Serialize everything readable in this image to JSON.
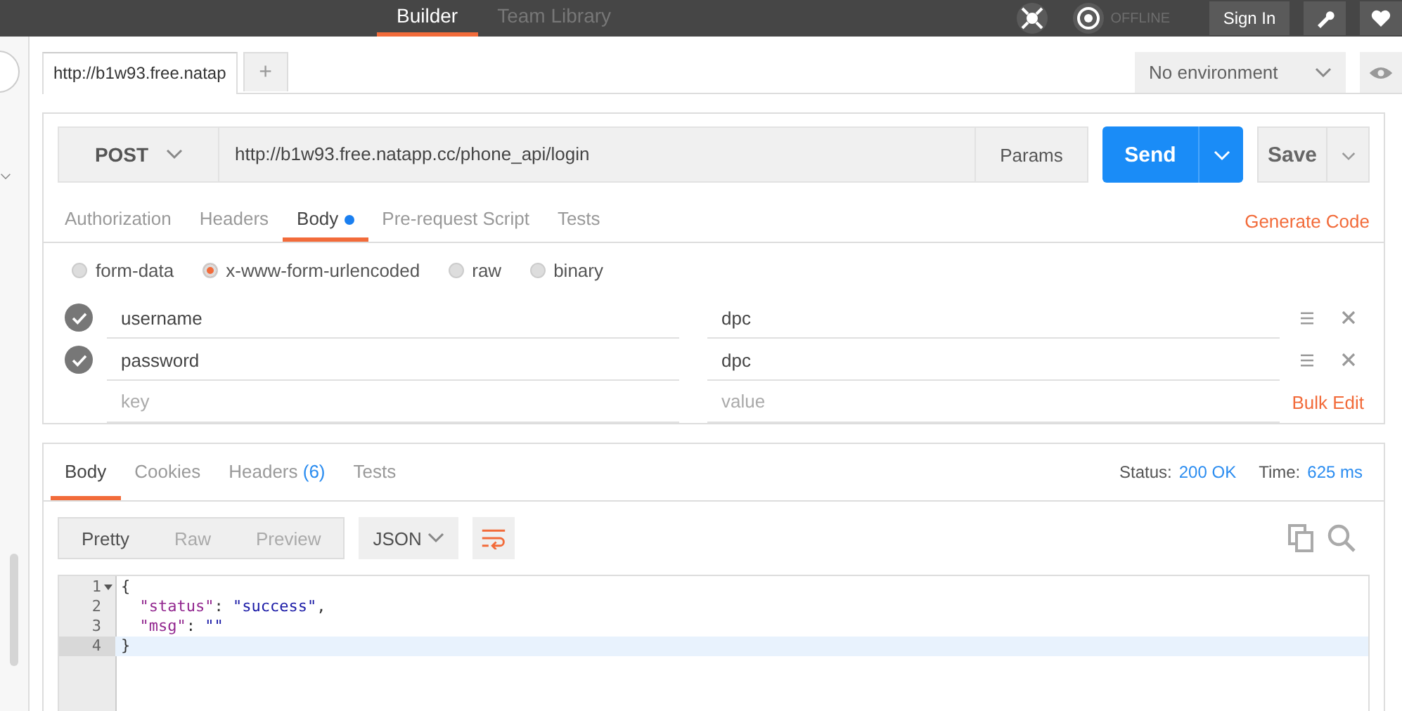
{
  "top_bar": {
    "tabs": [
      {
        "label": "Builder",
        "selected": true
      },
      {
        "label": "Team Library",
        "selected": false
      }
    ],
    "connection": "OFFLINE",
    "sign_in": "Sign In"
  },
  "request_tabs": [
    {
      "label": "http://b1w93.free.natap",
      "selected": true
    }
  ],
  "new_tab": "+",
  "environment": "No environment",
  "request": {
    "method": "POST",
    "url": "http://b1w93.free.natapp.cc/phone_api/login",
    "params": "Params",
    "send": "Send",
    "save": "Save"
  },
  "request_sections": [
    {
      "label": "Authorization",
      "selected": false,
      "dot": false
    },
    {
      "label": "Headers",
      "selected": false,
      "dot": false
    },
    {
      "label": "Body",
      "selected": true,
      "dot": true
    },
    {
      "label": "Pre-request Script",
      "selected": false,
      "dot": false
    },
    {
      "label": "Tests",
      "selected": false,
      "dot": false
    }
  ],
  "generate_code": "Generate Code",
  "body_types": [
    {
      "label": "form-data",
      "selected": false
    },
    {
      "label": "x-www-form-urlencoded",
      "selected": true
    },
    {
      "label": "raw",
      "selected": false
    },
    {
      "label": "binary",
      "selected": false
    }
  ],
  "params": [
    {
      "key": "username",
      "value": "dpc",
      "checked": true
    },
    {
      "key": "password",
      "value": "dpc",
      "checked": true
    }
  ],
  "new_param": {
    "key_placeholder": "key",
    "value_placeholder": "value"
  },
  "bulk_edit": "Bulk Edit",
  "response": {
    "tabs": [
      {
        "label": "Body",
        "selected": true
      },
      {
        "label": "Cookies",
        "selected": false
      },
      {
        "label": "Headers",
        "count": "(6)",
        "selected": false
      },
      {
        "label": "Tests",
        "selected": false
      }
    ],
    "status_label": "Status:",
    "status": "200 OK",
    "time_label": "Time:",
    "time": "625 ms",
    "views": [
      {
        "label": "Pretty",
        "selected": true
      },
      {
        "label": "Raw",
        "selected": false
      },
      {
        "label": "Preview",
        "selected": false
      }
    ],
    "format": "JSON",
    "lines": [
      {
        "number": "1",
        "fold": true,
        "segments": [
          {
            "kind": "punct",
            "text": "{"
          }
        ]
      },
      {
        "number": "2",
        "segments": [
          {
            "kind": "key",
            "text": "  \"status\""
          },
          {
            "kind": "punct",
            "text": ": "
          },
          {
            "kind": "string",
            "text": "\"success\""
          },
          {
            "kind": "punct",
            "text": ","
          }
        ]
      },
      {
        "number": "3",
        "segments": [
          {
            "kind": "key",
            "text": "  \"msg\""
          },
          {
            "kind": "punct",
            "text": ": "
          },
          {
            "kind": "string",
            "text": "\"\""
          }
        ]
      },
      {
        "number": "4",
        "current": true,
        "segments": [
          {
            "kind": "punct",
            "text": "}"
          }
        ]
      }
    ]
  }
}
